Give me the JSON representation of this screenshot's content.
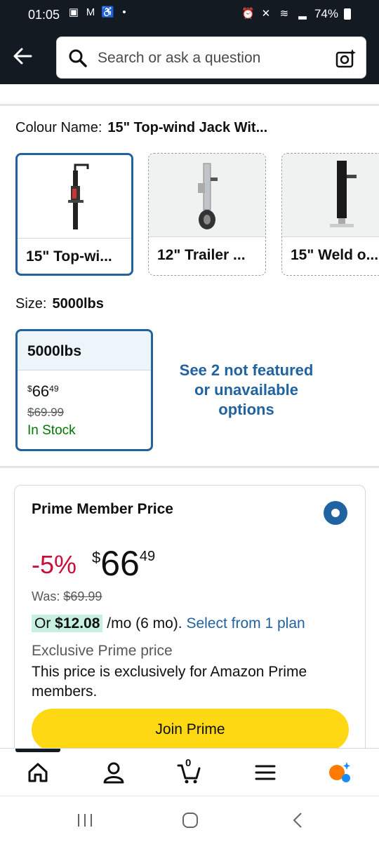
{
  "status_bar": {
    "time": "01:05",
    "battery": "74%"
  },
  "search": {
    "placeholder": "Search or ask a question"
  },
  "colour": {
    "label": "Colour Name:",
    "value": "15\" Top-wind Jack Wit...",
    "options": [
      {
        "label": "15\" Top-wi..."
      },
      {
        "label": "12\" Trailer ..."
      },
      {
        "label": "15\" Weld o..."
      }
    ]
  },
  "size": {
    "label": "Size:",
    "value": "5000lbs",
    "option": {
      "label": "5000lbs",
      "price_currency": "$",
      "price_whole": "66",
      "price_cents": "49",
      "was": "$69.99",
      "stock": "In Stock"
    },
    "see_more": "See 2 not featured or unavailable options"
  },
  "prime": {
    "title": "Prime Member Price",
    "discount": "-5%",
    "price_currency": "$",
    "price_whole": "66",
    "price_cents": "49",
    "was_label": "Was:",
    "was_value": "$69.99",
    "plan_or": "Or",
    "plan_amount": "$12.08",
    "plan_term": "/mo (6 mo).",
    "plan_link": "Select from 1 plan",
    "exclusive_title": "Exclusive Prime price",
    "exclusive_text": "This price is exclusively for Amazon Prime members.",
    "join_button": "Join Prime"
  },
  "bottom_nav": {
    "cart_count": "0"
  },
  "colors": {
    "header_bg": "#131a22",
    "link": "#2162a1",
    "discount": "#cc0c39",
    "stock": "#007600",
    "button": "#ffd814"
  }
}
